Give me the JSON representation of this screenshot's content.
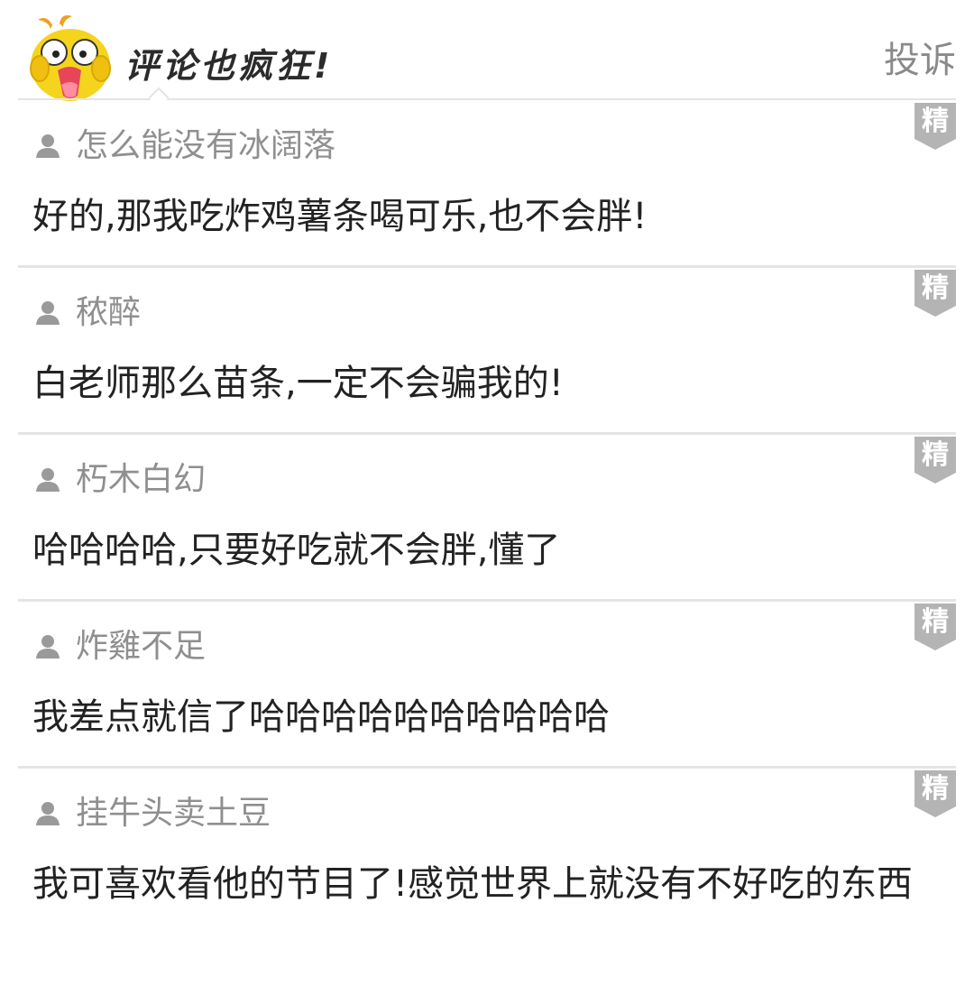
{
  "header": {
    "title": "评论也疯狂!",
    "report_label": "投诉",
    "mascot_icon": "duck-mascot-icon"
  },
  "colors": {
    "badge": "#b4b4b4",
    "divider": "#e4e4e4",
    "username": "#8f8f8f",
    "text": "#222222",
    "mascot": "#f5d41e"
  },
  "comments": [
    {
      "username": "怎么能没有冰阔落",
      "text": "好的,那我吃炸鸡薯条喝可乐,也不会胖!",
      "badge": "精"
    },
    {
      "username": "秾醉",
      "text": "白老师那么苗条,一定不会骗我的!",
      "badge": "精"
    },
    {
      "username": "朽木白幻",
      "text": "哈哈哈哈,只要好吃就不会胖,懂了",
      "badge": "精"
    },
    {
      "username": "炸雞不足",
      "text": "我差点就信了哈哈哈哈哈哈哈哈哈哈",
      "badge": "精"
    },
    {
      "username": "挂牛头卖土豆",
      "text": "我可喜欢看他的节目了!感觉世界上就没有不好吃的东西",
      "badge": "精"
    }
  ]
}
